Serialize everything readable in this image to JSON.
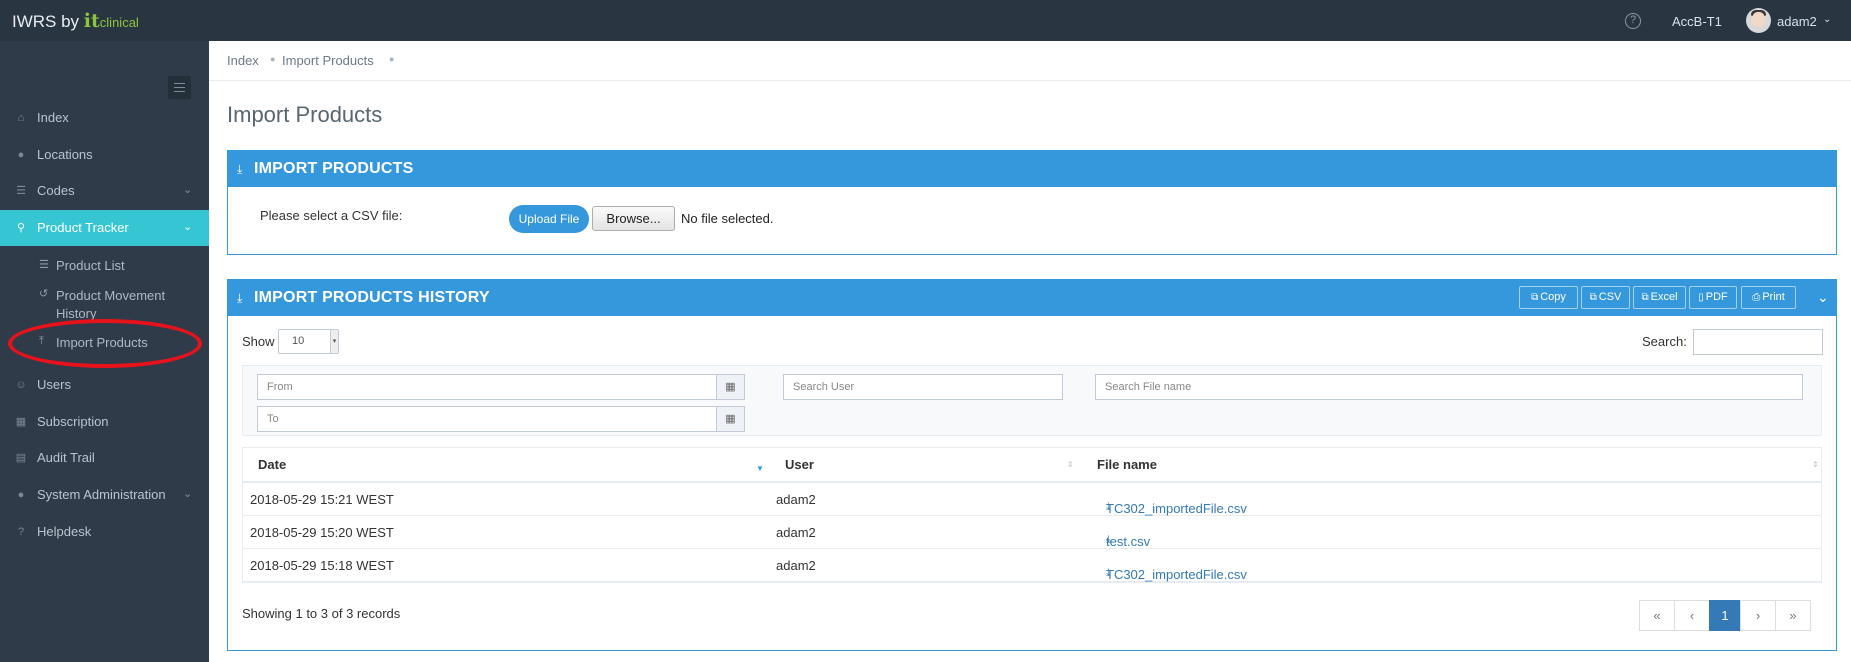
{
  "topbar": {
    "brand_prefix": "IWRS by",
    "brand_it": "it",
    "brand_clinical": "clinical",
    "help_icon": "?",
    "study": "AccB-T1",
    "user": "adam2",
    "user_caret": "⌄"
  },
  "sidebar": {
    "items": [
      {
        "label": "Index",
        "icon": "home-icon"
      },
      {
        "label": "Locations",
        "icon": "globe-icon"
      },
      {
        "label": "Codes",
        "icon": "list-icon"
      },
      {
        "label": "Product Tracker",
        "icon": "map-pin-icon"
      },
      {
        "label": "Users",
        "icon": "users-icon"
      },
      {
        "label": "Subscription",
        "icon": "table-icon"
      },
      {
        "label": "Audit Trail",
        "icon": "book-icon"
      },
      {
        "label": "System Administration",
        "icon": "globe-icon"
      },
      {
        "label": "Helpdesk",
        "icon": "question-icon"
      }
    ],
    "subitems": [
      {
        "label": "Product List",
        "icon": "list-icon"
      },
      {
        "label": "Product Movement History",
        "icon": "history-icon"
      },
      {
        "label": "Import Products",
        "icon": "upload-icon"
      }
    ],
    "active_color": "#36c6d3"
  },
  "breadcrumb": [
    "Index",
    "Import Products"
  ],
  "page_title": "Import Products",
  "import_panel": {
    "title": "IMPORT PRODUCTS",
    "csv_label": "Please select a CSV file:",
    "upload_label": "Upload File",
    "browse_label": "Browse...",
    "no_file": "No file selected."
  },
  "history_panel": {
    "title": "IMPORT PRODUCTS HISTORY",
    "tools": [
      "Copy",
      "CSV",
      "Excel",
      "PDF",
      "Print"
    ],
    "show_label": "Show",
    "show_value": "10",
    "search_label": "Search:",
    "filters": {
      "from_placeholder": "From",
      "to_placeholder": "To",
      "user_placeholder": "Search User",
      "file_placeholder": "Search File name"
    },
    "columns": [
      "Date",
      "User",
      "File name"
    ],
    "rows": [
      {
        "date": "2018-05-29 15:21 WEST",
        "user": "adam2",
        "file": "TC302_importedFile.csv"
      },
      {
        "date": "2018-05-29 15:20 WEST",
        "user": "adam2",
        "file": "test.csv"
      },
      {
        "date": "2018-05-29 15:18 WEST",
        "user": "adam2",
        "file": "TC302_importedFile.csv"
      }
    ],
    "showing": "Showing 1 to 3 of 3 records",
    "pager": [
      "«",
      "‹",
      "1",
      "›",
      "»"
    ]
  },
  "colors": {
    "topbar": "#2a3542",
    "sidebar": "#2f3b48",
    "panel_blue": "#3598dc",
    "highlight_red": "#e8121b"
  }
}
